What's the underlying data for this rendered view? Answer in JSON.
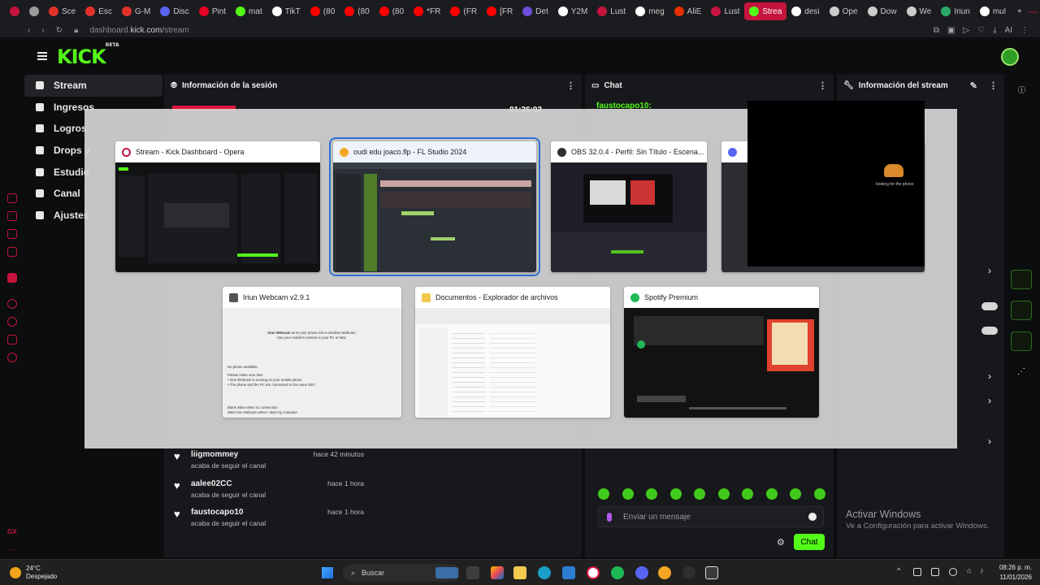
{
  "browser": {
    "tabs": [
      {
        "label": "",
        "color": "#c5143d"
      },
      {
        "label": "",
        "color": "#9a9a9a"
      },
      {
        "label": "Sce",
        "color": "#e0322b"
      },
      {
        "label": "Esc",
        "color": "#e0322b"
      },
      {
        "label": "G-M",
        "color": "#e0322b"
      },
      {
        "label": "Disc",
        "color": "#5865f2"
      },
      {
        "label": "Pint",
        "color": "#e60023"
      },
      {
        "label": "mat",
        "color": "#53fc18"
      },
      {
        "label": "TikT",
        "color": "#ffffff"
      },
      {
        "label": "(80",
        "color": "#ff0000"
      },
      {
        "label": "(80",
        "color": "#ff0000"
      },
      {
        "label": "(80",
        "color": "#ff0000"
      },
      {
        "label": "*FR",
        "color": "#ff0000"
      },
      {
        "label": "(FR",
        "color": "#ff0000"
      },
      {
        "label": "[FR",
        "color": "#ff0000"
      },
      {
        "label": "Det",
        "color": "#6b4fd8"
      },
      {
        "label": "Y2M",
        "color": "#ffffff"
      },
      {
        "label": "Lust",
        "color": "#c5143d"
      },
      {
        "label": "meg",
        "color": "#ffffff"
      },
      {
        "label": "AliE",
        "color": "#e62e04"
      },
      {
        "label": "Lust",
        "color": "#c5143d"
      },
      {
        "label": "Strea",
        "color": "#53fc18",
        "active": true
      },
      {
        "label": "desi",
        "color": "#ffffff"
      },
      {
        "label": "Ope",
        "color": "#cccccc"
      },
      {
        "label": "Dow",
        "color": "#cccccc"
      },
      {
        "label": "We",
        "color": "#cccccc"
      },
      {
        "label": "Iriun",
        "color": "#2ca86a"
      },
      {
        "label": "mul",
        "color": "#ffffff"
      }
    ],
    "url_prefix": "dashboard.",
    "url_domain": "kick.com",
    "url_path": "/stream",
    "ai_label": "AI"
  },
  "kick": {
    "logo": "KICK",
    "logo_beta": "BETA",
    "sidebar": [
      {
        "label": "Stream",
        "active": true
      },
      {
        "label": "Ingresos"
      },
      {
        "label": "Logros"
      },
      {
        "label": "Drops y"
      },
      {
        "label": "Estudio"
      },
      {
        "label": "Canal"
      },
      {
        "label": "Ajustes"
      }
    ],
    "panels": {
      "session": "Información de la sesión",
      "chat": "Chat",
      "stream_info": "Información del stream",
      "session_time": "01:26:03",
      "chat_user": "faustocapo10:"
    },
    "followers": [
      {
        "name": "liigmommey",
        "action": "acaba de seguir el canal",
        "time": "hace 42 minutos"
      },
      {
        "name": "aalee02CC",
        "action": "acaba de seguir el canal",
        "time": "hace 1 hora"
      },
      {
        "name": "faustocapo10",
        "action": "acaba de seguir el canal",
        "time": "hace 1 hora"
      }
    ],
    "chat_placeholder": "Enviar un mensaje",
    "chat_button": "Chat",
    "emote_count": 10
  },
  "switcher": {
    "windows": [
      {
        "title": "Stream - Kick Dashboard - Opera",
        "icon_color": "#c5143d"
      },
      {
        "title": "oudi edu joaco.flp - FL Studio 2024",
        "icon_color": "#f5a623",
        "selected": true
      },
      {
        "title": "OBS 32.0.4 - Perfil: Sin Título - Escena...",
        "icon_color": "#302e31",
        "close": "×"
      },
      {
        "title": "",
        "icon_color": "#5865f2"
      },
      {
        "title": "Iriun Webcam v2.9.1",
        "icon_color": "#555555"
      },
      {
        "title": "Documentos - Explorador de archivos",
        "icon_color": "#f2c94c"
      },
      {
        "title": "Spotify Premium",
        "icon_color": "#1db954"
      }
    ],
    "iriun": {
      "headline": "Iriun Webcam",
      "line1": "turns your phone into a wireless Webcam.",
      "line2": "Use your mobile's camera in your PC or Mac.",
      "no_phone": "No phone available.",
      "make_sure": "Please make sure that:",
      "bullet1": "• Iriun Webcam is running on your mobile phone",
      "bullet2": "• The phone and the PC are connected to the same WiFi",
      "opt1": "Blank video when no connection",
      "opt2": "Start Iriun Webcam when I start my computer"
    },
    "preview_text": "looking for the phone"
  },
  "windows_notice": {
    "title": "Activar Windows",
    "subtitle": "Ve a Configuración para activar Windows."
  },
  "taskbar": {
    "temp": "24°C",
    "weather": "Despejado",
    "search_placeholder": "Buscar",
    "time": "08:26 p. m.",
    "date": "11/01/2026"
  }
}
